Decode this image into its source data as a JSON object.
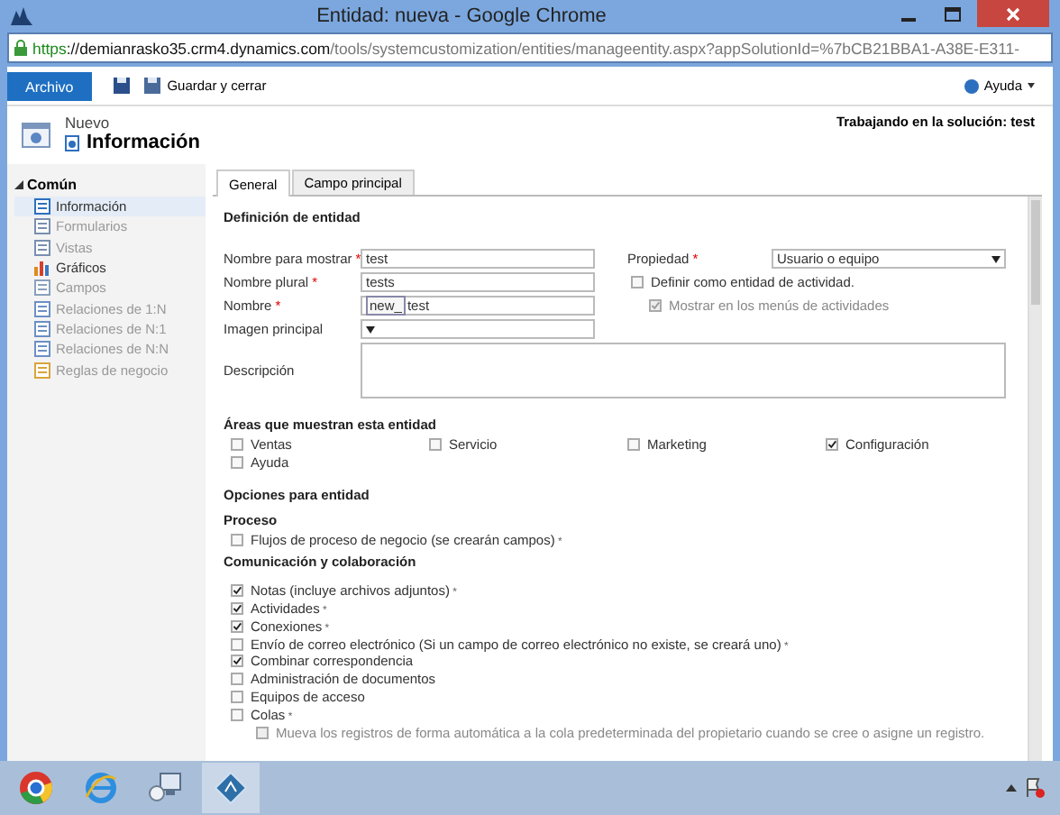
{
  "window": {
    "title": "Entidad: nueva - Google Chrome"
  },
  "address_bar": {
    "scheme": "https",
    "host": "://demianrasko35.crm4.dynamics.com",
    "path": "/tools/systemcustomization/entities/manageentity.aspx?appSolutionId=%7bCB21BBA1-A38E-E311-"
  },
  "ribbon": {
    "file_tab": "Archivo",
    "save_and_close": "Guardar y cerrar",
    "help": "Ayuda"
  },
  "header": {
    "state": "Nuevo",
    "title": "Información",
    "solution": "Trabajando en la solución: test"
  },
  "sidebar": {
    "group": {
      "label": "Común",
      "expanded": true,
      "children": [
        {
          "label": "Información",
          "selected": true,
          "disabled": false
        },
        {
          "label": "Formularios",
          "selected": false,
          "disabled": true
        },
        {
          "label": "Vistas",
          "selected": false,
          "disabled": true
        },
        {
          "label": "Gráficos",
          "selected": false,
          "disabled": false
        },
        {
          "label": "Campos",
          "selected": false,
          "disabled": true
        },
        {
          "label": "Relaciones de 1:N",
          "selected": false,
          "disabled": true
        },
        {
          "label": "Relaciones de N:1",
          "selected": false,
          "disabled": true
        },
        {
          "label": "Relaciones de N:N",
          "selected": false,
          "disabled": true
        },
        {
          "label": "Reglas de negocio",
          "selected": false,
          "disabled": true
        }
      ]
    }
  },
  "tabs": [
    {
      "label": "General",
      "selected": true
    },
    {
      "label": "Campo principal",
      "selected": false
    }
  ],
  "definition": {
    "heading": "Definición de entidad",
    "fields": [
      {
        "kind": "text",
        "label": "Nombre para mostrar",
        "required_mark": "*",
        "value": "test"
      },
      {
        "kind": "text",
        "label": "Nombre plural",
        "required_mark": "*",
        "value": "tests"
      },
      {
        "kind": "prefixed",
        "label": "Nombre",
        "required_mark": "*",
        "prefix": "new_",
        "value": "test"
      },
      {
        "kind": "select",
        "label": "Imagen principal"
      },
      {
        "kind": "textarea",
        "label": "Descripción"
      }
    ],
    "ownership": {
      "label": "Propiedad",
      "required_mark": "*",
      "value": "Usuario o equipo"
    },
    "activity": {
      "label": "Definir como entidad de actividad.",
      "checked": false,
      "disabled": false
    },
    "activity_menu": {
      "label": "Mostrar en los menús de actividades",
      "checked": true,
      "disabled": true
    }
  },
  "areas": {
    "heading": "Áreas que muestran esta entidad",
    "items": [
      {
        "label": "Ventas",
        "checked": false
      },
      {
        "label": "Servicio",
        "checked": false
      },
      {
        "label": "Marketing",
        "checked": false
      },
      {
        "label": "Configuración",
        "checked": true
      },
      {
        "label": "Ayuda",
        "checked": false
      }
    ]
  },
  "options": {
    "heading": "Opciones para entidad",
    "sections": [
      {
        "heading": "Proceso",
        "items": [
          {
            "label": "Flujos de proceso de negocio (se crearán campos)",
            "mark": "*",
            "checked": false,
            "disabled": false
          }
        ]
      },
      {
        "heading": "Comunicación y colaboración",
        "items": [
          {
            "label": "Notas (incluye archivos adjuntos)",
            "mark": "*",
            "checked": true,
            "disabled": false
          },
          {
            "label": "Actividades",
            "mark": "*",
            "checked": true,
            "disabled": false
          },
          {
            "label": "Conexiones",
            "mark": "*",
            "checked": true,
            "disabled": false
          },
          {
            "label": "Envío de correo electrónico (Si un campo de correo electrónico no existe, se creará uno)",
            "mark": "*",
            "checked": false,
            "disabled": false
          },
          {
            "label": "Combinar correspondencia",
            "checked": true,
            "disabled": false
          },
          {
            "label": "Administración de documentos",
            "checked": false,
            "disabled": false
          },
          {
            "label": "Equipos de acceso",
            "checked": false,
            "disabled": false
          },
          {
            "label": "Colas",
            "mark": "*",
            "checked": false,
            "disabled": false,
            "children": [
              {
                "label": "Mueva los registros de forma automática a la cola predeterminada del propietario cuando se cree o asigne un registro.",
                "checked": false,
                "disabled": true
              }
            ]
          }
        ]
      }
    ]
  },
  "taskbar": {
    "apps": [
      {
        "kind": "chrome",
        "selected": false
      },
      {
        "kind": "ie",
        "selected": false
      },
      {
        "kind": "network",
        "selected": false
      },
      {
        "kind": "app",
        "selected": true
      }
    ]
  }
}
